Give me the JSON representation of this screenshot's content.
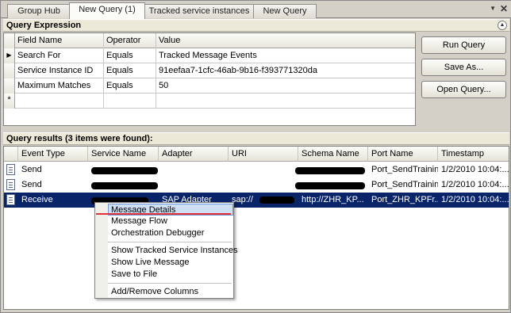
{
  "tabs": [
    {
      "label": "Group Hub",
      "active": false
    },
    {
      "label": "New Query (1)",
      "active": true
    },
    {
      "label": "Tracked service instances",
      "active": false
    },
    {
      "label": "New Query",
      "active": false
    }
  ],
  "query_expression": {
    "title": "Query Expression",
    "columns": [
      "Field Name",
      "Operator",
      "Value"
    ],
    "rows": [
      {
        "field": "Search For",
        "operator": "Equals",
        "value": "Tracked Message Events"
      },
      {
        "field": "Service Instance ID",
        "operator": "Equals",
        "value": "91eefaa7-1cfc-46ab-9b16-f393771320da"
      },
      {
        "field": "Maximum Matches",
        "operator": "Equals",
        "value": "50"
      }
    ],
    "new_row_marker": "*"
  },
  "buttons": {
    "run_query": "Run Query",
    "save_as": "Save As...",
    "open_query": "Open Query..."
  },
  "results": {
    "title": "Query results (3 items were found):",
    "columns": [
      "Event Type",
      "Service Name",
      "Adapter",
      "URI",
      "Schema Name",
      "Port Name",
      "Timestamp"
    ],
    "rows": [
      {
        "event_type": "Send",
        "adapter": "",
        "uri": "",
        "schema": "",
        "port": "Port_SendTrainin...",
        "timestamp": "1/2/2010 10:04:..."
      },
      {
        "event_type": "Send",
        "adapter": "",
        "uri": "",
        "schema": "",
        "port": "Port_SendTrainin...",
        "timestamp": "1/2/2010 10:04:..."
      },
      {
        "event_type": "Receive",
        "adapter": "SAP Adapter",
        "uri": "sap://",
        "schema": "http://ZHR_KP...",
        "port": "Port_ZHR_KPFr...",
        "timestamp": "1/2/2010 10:04:..."
      }
    ]
  },
  "context_menu": {
    "items": [
      {
        "label": "Message Details",
        "highlighted": true
      },
      {
        "label": "Message Flow"
      },
      {
        "label": "Orchestration Debugger"
      },
      {
        "label": "Show Tracked Service Instances"
      },
      {
        "label": "Show Live Message"
      },
      {
        "label": "Save to File"
      },
      {
        "label": "Add/Remove Columns"
      }
    ]
  },
  "colors": {
    "selection": "#0a246a",
    "menu_highlight": "#cfe0f5",
    "annotation_underline": "#e0303a"
  }
}
